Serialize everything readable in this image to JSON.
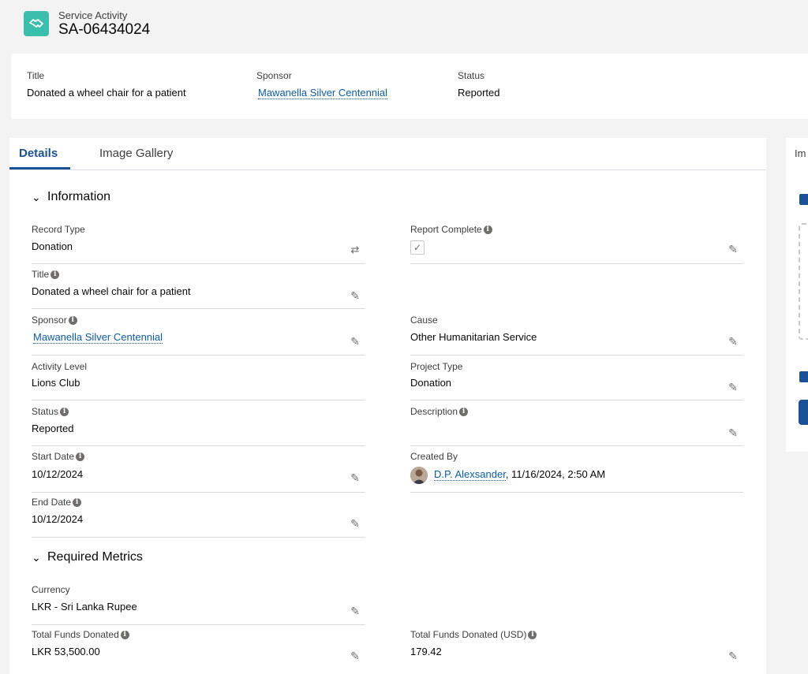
{
  "header": {
    "object_type": "Service Activity",
    "record_name": "SA-06434024",
    "icon": "handshake-icon",
    "icon_color": "#3bbfad"
  },
  "highlights": [
    {
      "label": "Title",
      "value": "Donated a wheel chair for a patient"
    },
    {
      "label": "Sponsor",
      "value": "Mawanella Silver Centennial"
    },
    {
      "label": "Status",
      "value": "Reported"
    }
  ],
  "tabs": [
    {
      "label": "Details",
      "active": true
    },
    {
      "label": "Image Gallery",
      "active": false
    }
  ],
  "sections": {
    "information": "Information",
    "required_metrics": "Required Metrics"
  },
  "fields": {
    "record_type": {
      "label": "Record Type",
      "value": "Donation"
    },
    "report_complete": {
      "label": "Report Complete",
      "checked": true
    },
    "title": {
      "label": "Title",
      "value": "Donated a wheel chair for a patient"
    },
    "sponsor": {
      "label": "Sponsor",
      "value": "Mawanella Silver Centennial"
    },
    "cause": {
      "label": "Cause",
      "value": "Other Humanitarian Service"
    },
    "activity_level": {
      "label": "Activity Level",
      "value": "Lions Club"
    },
    "project_type": {
      "label": "Project Type",
      "value": "Donation"
    },
    "status": {
      "label": "Status",
      "value": "Reported"
    },
    "description": {
      "label": "Description",
      "value": ""
    },
    "start_date": {
      "label": "Start Date",
      "value": "10/12/2024"
    },
    "created_by": {
      "label": "Created By",
      "user": "D.P. Alexsander",
      "datetime": ", 11/16/2024, 2:50 AM"
    },
    "end_date": {
      "label": "End Date",
      "value": "10/12/2024"
    },
    "currency": {
      "label": "Currency",
      "value": "LKR - Sri Lanka Rupee"
    },
    "total_funds": {
      "label": "Total Funds Donated",
      "value": "LKR 53,500.00"
    },
    "total_funds_usd": {
      "label": "Total Funds Donated (USD)",
      "value": "179.42"
    }
  },
  "side_panel": {
    "label": "Im"
  },
  "colors": {
    "link": "#0b5cab",
    "brand": "#1b5297"
  }
}
